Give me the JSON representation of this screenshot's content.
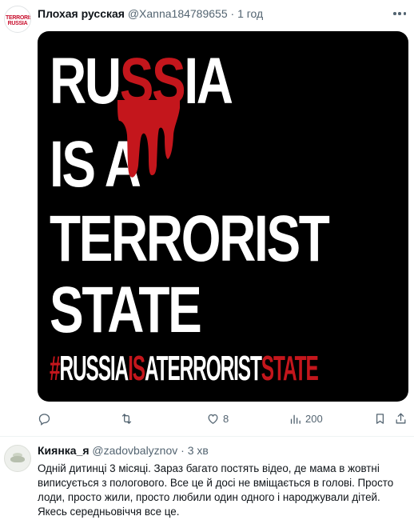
{
  "tweets": [
    {
      "author_name": "Плохая русская",
      "handle": "@Xanna184789655",
      "separator": "·",
      "time": "1 год",
      "avatar_text": [
        "TERRORISM",
        "RUSSIA"
      ],
      "media": {
        "lines": [
          {
            "parts": [
              {
                "text": "RU",
                "red": false
              },
              {
                "text": "SS",
                "red": true
              },
              {
                "text": "IA",
                "red": false
              }
            ]
          },
          {
            "parts": [
              {
                "text": "IS A",
                "red": false
              }
            ]
          },
          {
            "parts": [
              {
                "text": "TERRORIST",
                "red": false
              }
            ]
          },
          {
            "parts": [
              {
                "text": "STATE",
                "red": false
              }
            ]
          }
        ],
        "hashtag": [
          {
            "text": "#",
            "red": true
          },
          {
            "text": "RUSSIA",
            "red": false
          },
          {
            "text": "IS",
            "red": true
          },
          {
            "text": "A",
            "red": false
          },
          {
            "text": "TERRORIST",
            "red": false
          },
          {
            "text": "STATE",
            "red": true
          }
        ]
      },
      "actions": {
        "reply": {
          "icon": "reply-icon",
          "count": ""
        },
        "retweet": {
          "icon": "retweet-icon",
          "count": ""
        },
        "like": {
          "icon": "heart-icon",
          "count": "8"
        },
        "views": {
          "icon": "views-icon",
          "count": "200"
        },
        "bookmark": {
          "icon": "bookmark-icon"
        },
        "share": {
          "icon": "share-icon"
        }
      }
    },
    {
      "author_name": "Киянка_я",
      "handle": "@zadovbalyznov",
      "separator": "·",
      "time": "3 хв",
      "text_lines": [
        "Одній дитинці 3 місяці. Зараз багато постять відео, де мама в жовтні",
        "виписується з пологового. Все це й досі не вміщається в голові. Просто",
        "лоди, просто жили, просто любили один одного і народжували дітей.",
        "Якесь середньовіччя все це."
      ]
    }
  ],
  "colors": {
    "accent_red": "#c4161c",
    "secondary_text": "#536471",
    "primary_text": "#0f1419"
  }
}
